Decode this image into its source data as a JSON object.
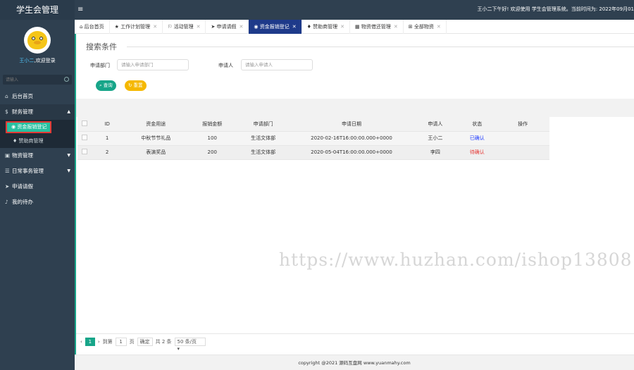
{
  "app": {
    "title": "学生会管理"
  },
  "user": {
    "name": "王小二",
    "welcome_suffix": ",欢迎登录"
  },
  "sidebar": {
    "search_placeholder": "请输入",
    "items": [
      {
        "label": "后台首页",
        "icon": "home-icon"
      },
      {
        "label": "财务管理",
        "icon": "finance-icon",
        "open": true,
        "children": [
          {
            "label": "资金报销登记",
            "active": true
          },
          {
            "label": "赞助商管理"
          }
        ]
      },
      {
        "label": "物资管理",
        "icon": "box-icon"
      },
      {
        "label": "日常事务管理",
        "icon": "list-icon"
      },
      {
        "label": "申请请假",
        "icon": "send-icon"
      },
      {
        "label": "我的待办",
        "icon": "bell-icon"
      }
    ]
  },
  "topbar": {
    "menu_icon": "menu-icon",
    "greeting": "王小二下午好!  欢迎使用 学生会管理系统。当前时间为:  2022年09月01"
  },
  "tabs": [
    {
      "label": "后台首页",
      "icon": "home-icon",
      "closable": false
    },
    {
      "label": "工作计划管理",
      "icon": "star-icon",
      "closable": true
    },
    {
      "label": "活动管理",
      "icon": "flag-icon",
      "closable": true
    },
    {
      "label": "申请请假",
      "icon": "send-icon",
      "closable": true
    },
    {
      "label": "资金报销登记",
      "icon": "circle-icon",
      "closable": true,
      "active": true
    },
    {
      "label": "赞助商管理",
      "icon": "diamond-icon",
      "closable": true
    },
    {
      "label": "物资借还管理",
      "icon": "calendar-icon",
      "closable": true
    },
    {
      "label": "全部物资",
      "icon": "grid-icon",
      "closable": true
    }
  ],
  "search": {
    "title": "搜索条件",
    "dept_label": "申请部门",
    "dept_placeholder": "请输入申请部门",
    "applicant_label": "申请人",
    "applicant_placeholder": "请输入申请人",
    "query_button": "查询",
    "reset_button": "重置"
  },
  "table": {
    "headers": [
      "ID",
      "资金用途",
      "报销金额",
      "申请部门",
      "申请日期",
      "申请人",
      "状态",
      "操作"
    ],
    "rows": [
      {
        "id": "1",
        "purpose": "中秋节节礼品",
        "amount": "100",
        "dept": "生活文体部",
        "date": "2020-02-16T16:00:00.000+0000",
        "applicant": "王小二",
        "status": "已确认",
        "status_type": "ok"
      },
      {
        "id": "2",
        "purpose": "表演奖品",
        "amount": "200",
        "dept": "生活文体部",
        "date": "2020-05-04T16:00:00.000+0000",
        "applicant": "李四",
        "status": "待确认",
        "status_type": "wait"
      }
    ]
  },
  "watermark": "https://www.huzhan.com/ishop13808",
  "pager": {
    "prev": "‹",
    "current": "1",
    "next": "›",
    "goto_label": "到第",
    "goto_value": "1",
    "page_unit": "页",
    "confirm": "确定",
    "total": "共 2 条",
    "page_size": "50 条/页"
  },
  "footer": {
    "text": "copyright @2021 源码互盘网 www.yuanmahy.com"
  },
  "colors": {
    "sidebar": "#2f4050",
    "accent": "#17a589",
    "active_tab": "#1e3a8a",
    "reset": "#f5b800"
  }
}
